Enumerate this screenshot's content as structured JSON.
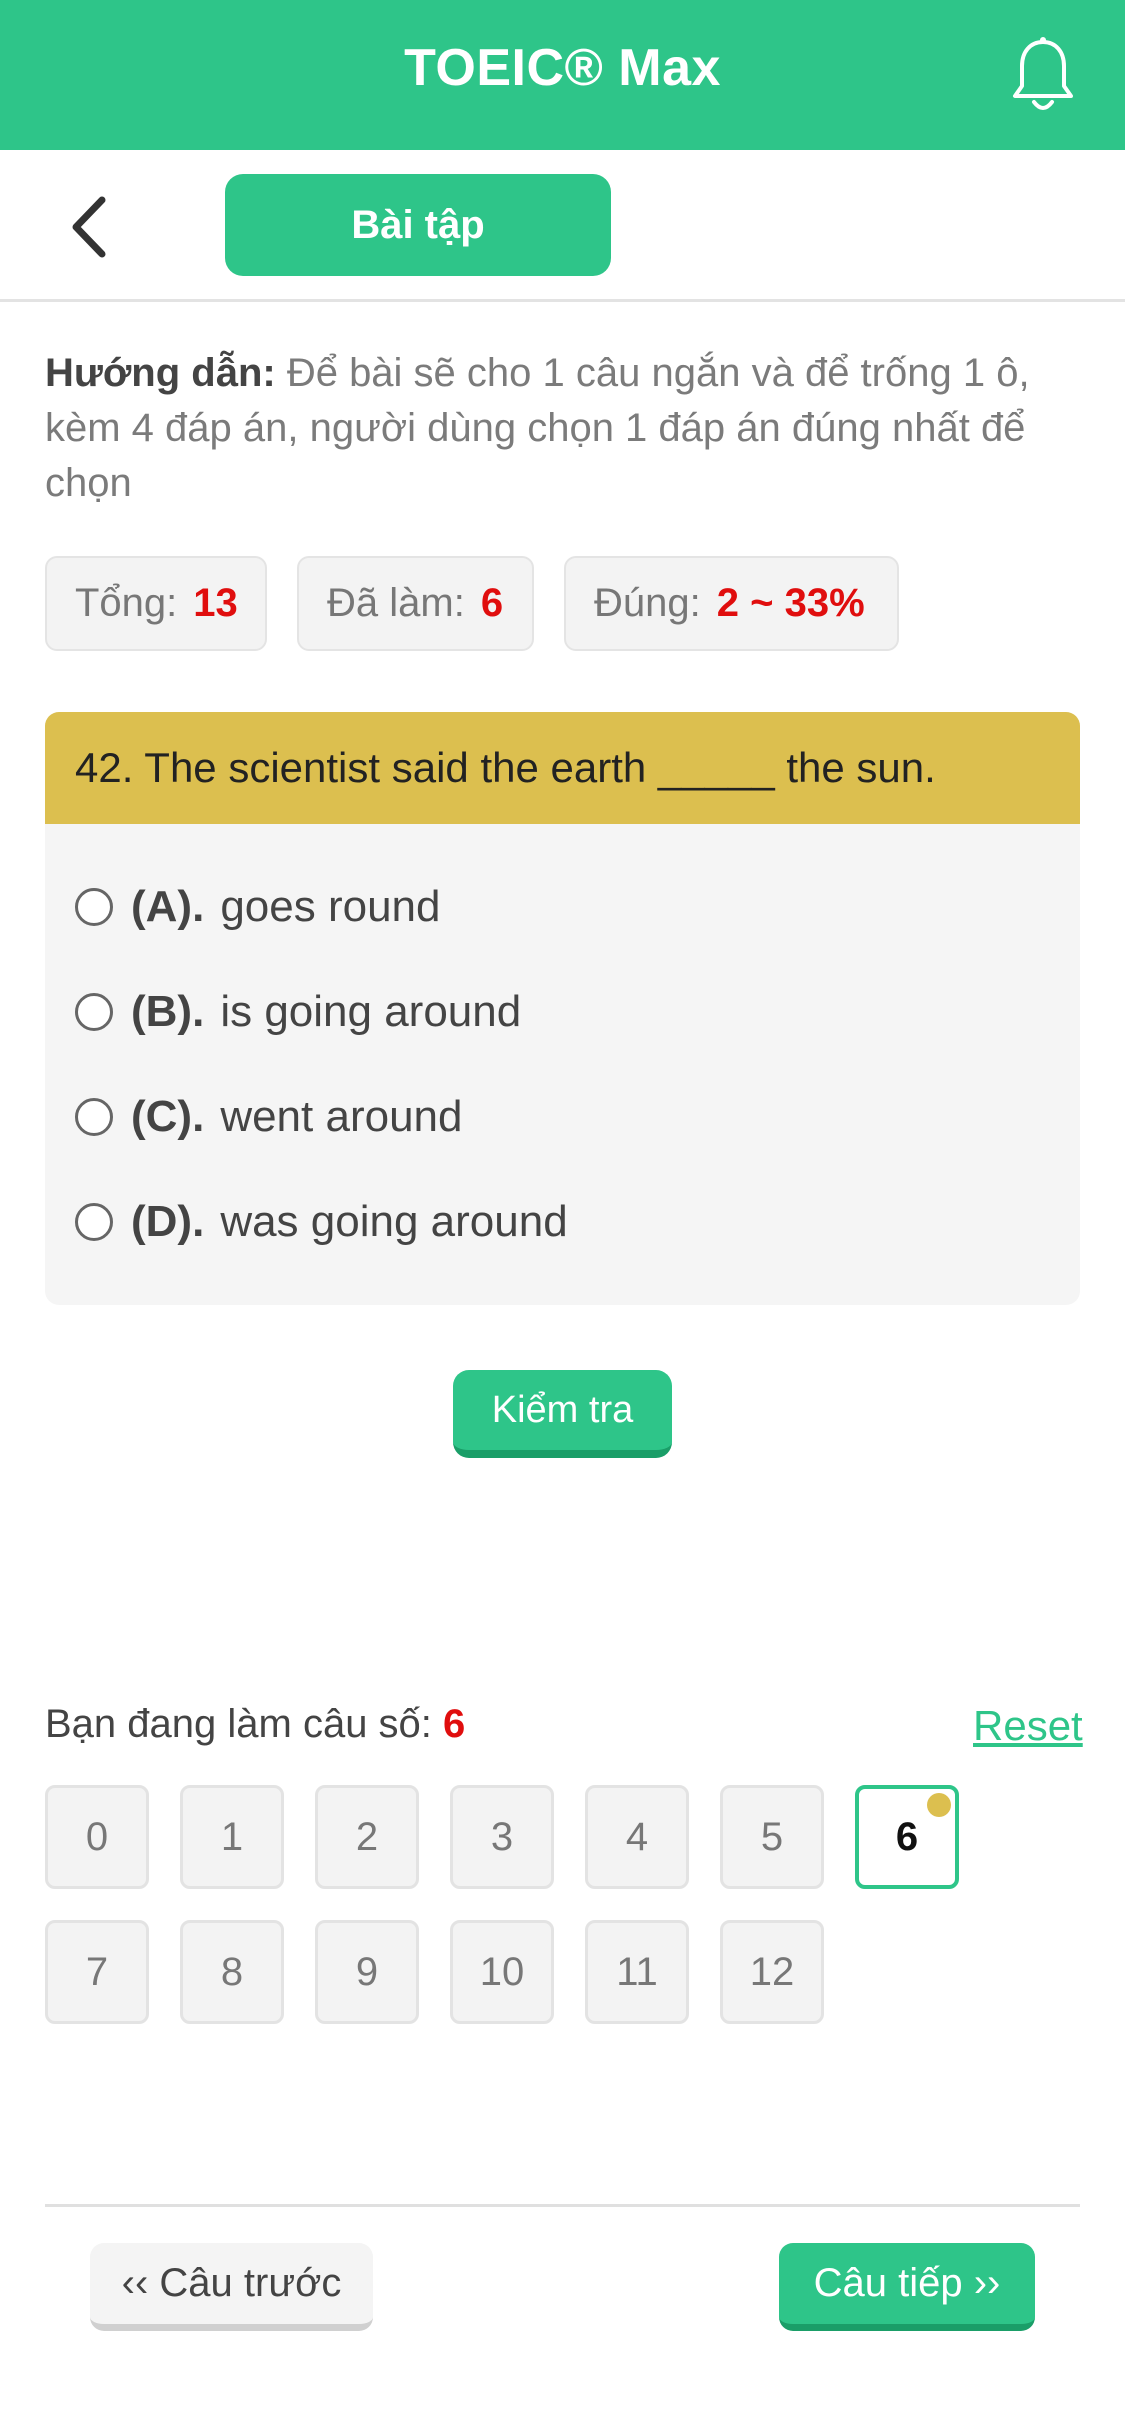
{
  "header": {
    "title": "TOEIC® Max",
    "bell_icon": "bell-icon"
  },
  "subbar": {
    "back_icon": "chevron-left-icon",
    "tab_label": "Bài tập"
  },
  "instructions": {
    "label": "Hướng dẫn:",
    "text": " Để bài sẽ cho 1 câu ngắn và để trống 1 ô, kèm 4 đáp án, người dùng chọn 1 đáp án đúng nhất để chọn"
  },
  "stats": {
    "total_label": "Tổng:",
    "total_value": "13",
    "done_label": "Đã làm:",
    "done_value": "6",
    "correct_label": "Đúng:",
    "correct_value": "2 ~ 33%"
  },
  "question": {
    "text": "42. The scientist said the earth _____ the sun.",
    "options": [
      {
        "letter": "(A).",
        "text": "goes round"
      },
      {
        "letter": "(B).",
        "text": "is going around"
      },
      {
        "letter": "(C).",
        "text": "went around"
      },
      {
        "letter": "(D).",
        "text": "was going around"
      }
    ]
  },
  "check_button": "Kiểm tra",
  "navigator": {
    "current_label": "Bạn đang làm câu số:",
    "current_value": "6",
    "reset_label": "Reset",
    "numbers": [
      "0",
      "1",
      "2",
      "3",
      "4",
      "5",
      "6",
      "7",
      "8",
      "9",
      "10",
      "11",
      "12"
    ],
    "active": "6",
    "marker_color": "#dcbf4f"
  },
  "footer": {
    "prev_label": "‹‹ Câu trước",
    "next_label": "Câu tiếp ››"
  },
  "colors": {
    "brand": "#2ec589",
    "question_header": "#dcbf4f",
    "highlight": "#e00e0e"
  }
}
